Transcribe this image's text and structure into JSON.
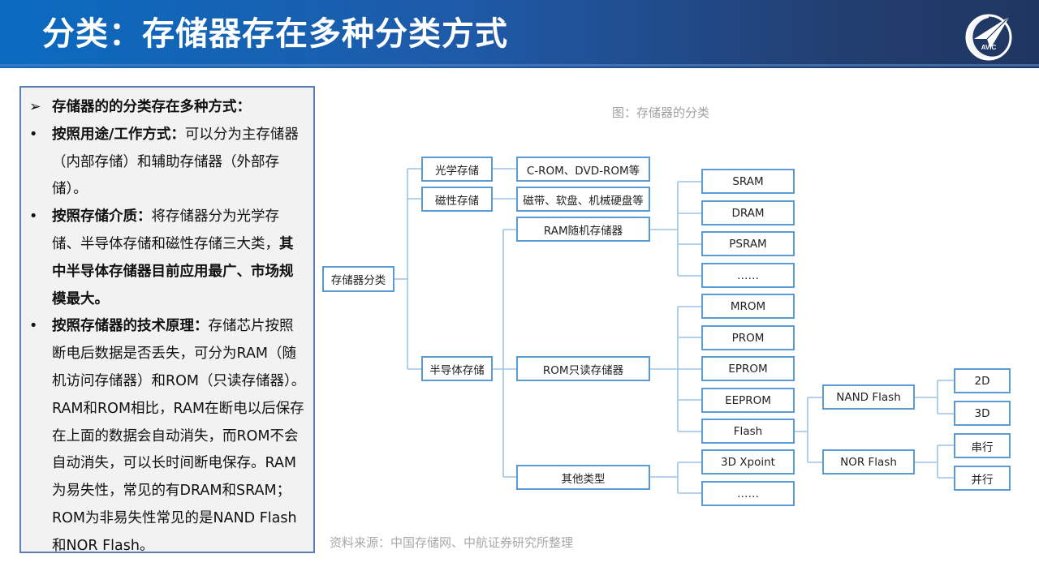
{
  "header": {
    "title": "分类：存储器存在多种分类方式",
    "logo_text": "AVIC"
  },
  "left_panel": {
    "intro": "存储器的的分类存在多种方式：",
    "points": [
      {
        "bold": "按照用途/工作方式：",
        "text": "可以分为主存储器（内部存储）和辅助存储器（外部存储）。"
      },
      {
        "bold": "按照存储介质：",
        "text": "将存储器分为光学存储、半导体存储和磁性存储三大类，",
        "bold_tail": "其中半导体存储器目前应用最广、市场规模最大。"
      },
      {
        "bold": "按照存储器的技术原理：",
        "text": "存储芯片按照断电后数据是否丢失，可分为RAM（随机访问存储器）和ROM（只读存储器）。RAM和ROM相比，RAM在断电以后保存在上面的数据会自动消失，而ROM不会自动消失，可以长时间断电保存。RAM为易失性，常见的有DRAM和SRAM；ROM为非易失性常见的是NAND Flash和NOR Flash。"
      }
    ]
  },
  "diagram": {
    "caption": "图：存储器的分类",
    "source": "资料来源：中国存储网、中航证券研究所整理",
    "line_color": "#9dc3e6",
    "border_color": "#5b9bd5",
    "nodes": {
      "root": "存储器分类",
      "optical": "光学存储",
      "optical_ex": "C-ROM、DVD-ROM等",
      "magnetic": "磁性存储",
      "magnetic_ex": "磁带、软盘、机械硬盘等",
      "semi": "半导体存储",
      "ram": "RAM随机存储器",
      "rom": "ROM只读存储器",
      "other": "其他类型",
      "sram": "SRAM",
      "dram": "DRAM",
      "psram": "PSRAM",
      "ram_more": "……",
      "mrom": "MROM",
      "prom": "PROM",
      "eprom": "EPROM",
      "eeprom": "EEPROM",
      "flash": "Flash",
      "xpoint": "3D Xpoint",
      "other_more": "……",
      "nand": "NAND Flash",
      "nor": "NOR Flash",
      "d2": "2D",
      "d3": "3D",
      "serial": "串行",
      "parallel": "并行"
    }
  }
}
